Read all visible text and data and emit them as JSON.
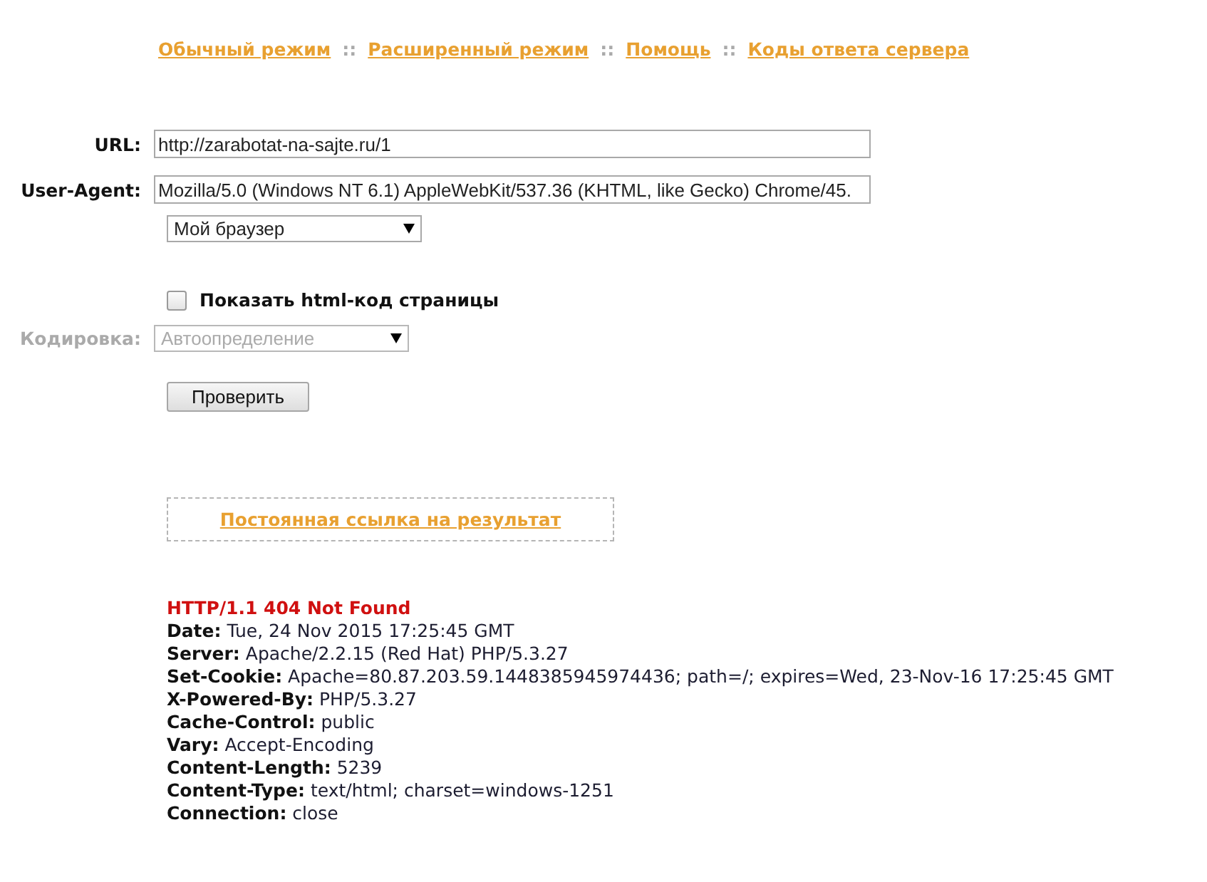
{
  "nav": [
    {
      "kind": "link",
      "text": "Обычный режим"
    },
    {
      "kind": "separator",
      "text": "::"
    },
    {
      "kind": "link",
      "text": "Расширенный режим"
    },
    {
      "kind": "separator",
      "text": "::"
    },
    {
      "kind": "link",
      "text": "Помощь"
    },
    {
      "kind": "separator",
      "text": "::"
    },
    {
      "kind": "link",
      "text": "Коды ответа сервера"
    }
  ],
  "form": {
    "url": {
      "label": "URL:",
      "value": "http://zarabotat-na-sajte.ru/1"
    },
    "user_agent": {
      "label": "User-Agent:",
      "value": "Mozilla/5.0 (Windows NT 6.1) AppleWebKit/537.36 (KHTML, like Gecko) Chrome/45."
    },
    "browser_select": {
      "value": "Мой браузер"
    },
    "show_html": {
      "label": "Показать html-код страницы",
      "checked": false
    },
    "encoding": {
      "label": "Кодировка:",
      "value": "Автоопределение",
      "disabled": true
    },
    "submit": {
      "label": "Проверить"
    }
  },
  "permalink": {
    "label": "Постоянная ссылка на результат"
  },
  "response": {
    "status": "HTTP/1.1 404 Not Found",
    "headers": [
      {
        "name": "Date:",
        "value": "Tue, 24 Nov 2015 17:25:45 GMT"
      },
      {
        "name": "Server:",
        "value": "Apache/2.2.15 (Red Hat) PHP/5.3.27"
      },
      {
        "name": "Set-Cookie:",
        "value": "Apache=80.87.203.59.1448385945974436; path=/; expires=Wed, 23-Nov-16 17:25:45 GMT"
      },
      {
        "name": "X-Powered-By:",
        "value": "PHP/5.3.27"
      },
      {
        "name": "Cache-Control:",
        "value": "public"
      },
      {
        "name": "Vary:",
        "value": "Accept-Encoding"
      },
      {
        "name": "Content-Length:",
        "value": "5239"
      },
      {
        "name": "Content-Type:",
        "value": "text/html; charset=windows-1251"
      },
      {
        "name": "Connection:",
        "value": "close"
      }
    ]
  }
}
